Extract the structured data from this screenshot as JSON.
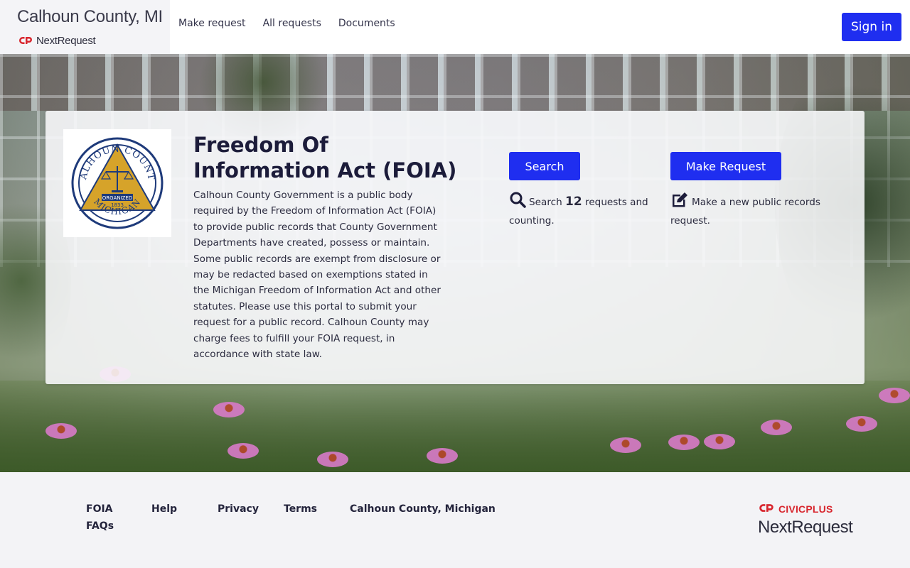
{
  "header": {
    "brand_title": "Calhoun County, MI",
    "brand_sub": "NextRequest",
    "nav": [
      "Make request",
      "All requests",
      "Documents"
    ],
    "signin_label": "Sign in"
  },
  "card": {
    "seal_text": {
      "top": "CALHOUN COUNTY",
      "bottom": "MICHIGAN",
      "organized": "ORGANIZED",
      "year": "1833"
    },
    "title": "Freedom Of Information Act (FOIA)",
    "description": "Calhoun County Government is a public body required by the Freedom of Information Act (FOIA) to provide public records that County Government Departments have created, possess or maintain. Some public records are exempt from disclosure or may be redacted based on exemptions stated in the Michigan Freedom of Information Act and other statutes. Please use this portal to submit your request for a public record. Calhoun County may charge fees to fulfill your FOIA request, in accordance with state law.",
    "search": {
      "button_label": "Search",
      "text_pre": "Search",
      "count": "12",
      "text_post": "requests and counting.",
      "icon": "search-icon"
    },
    "make": {
      "button_label": "Make Request",
      "text": "Make a new public records request.",
      "icon": "edit-icon"
    }
  },
  "footer": {
    "links": {
      "foia": "FOIA",
      "faqs": "FAQs",
      "help": "Help",
      "privacy": "Privacy",
      "terms": "Terms",
      "county": "Calhoun County, Michigan"
    },
    "civicplus": "CIVICPLUS",
    "nextrequest": "NextRequest"
  },
  "colors": {
    "primary": "#1f2ef0",
    "brand_red": "#d8262e",
    "seal_blue": "#1e3a7a",
    "seal_gold": "#d6a32a"
  }
}
